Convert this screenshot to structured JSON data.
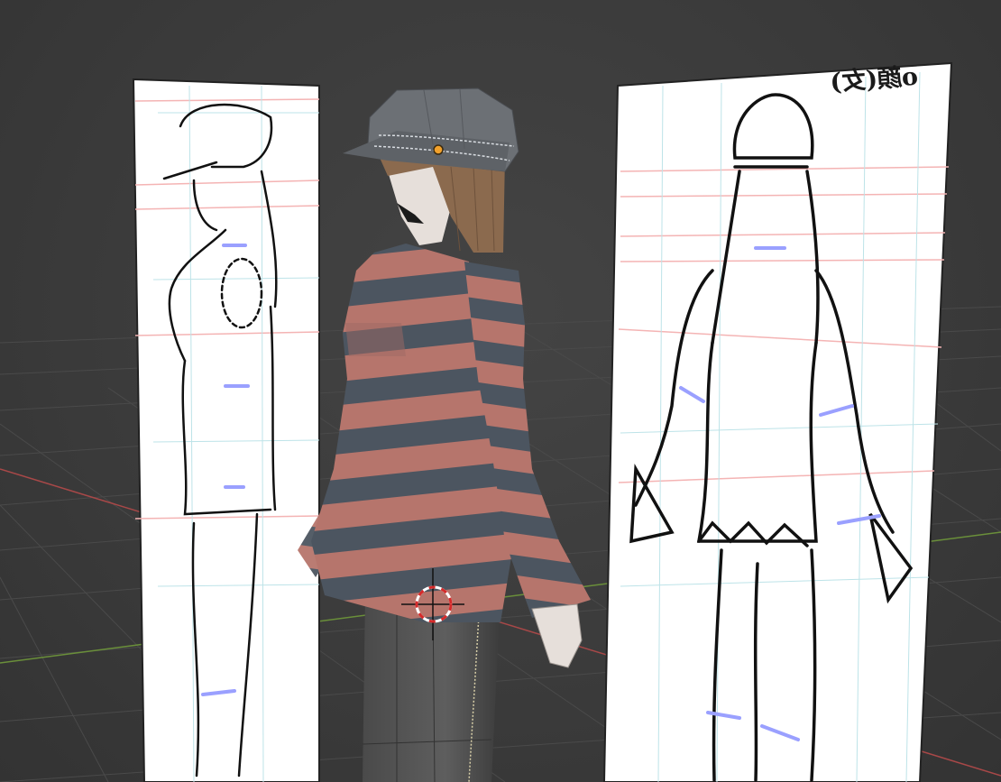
{
  "viewport": {
    "background_color": "#3d3d3d",
    "grid_color": "#4a4a4a",
    "x_axis_color": "#b34a4a",
    "y_axis_color": "#6a8f3a"
  },
  "reference_images": {
    "side_view": {
      "name": "side-view-sketch"
    },
    "front_view": {
      "name": "front-view-sketch",
      "label": "o顔(女)"
    }
  },
  "model": {
    "cap_color": "#6c7075",
    "hair_color": "#8b6a4e",
    "skin_color": "#e6dfda",
    "sweater_stripe_colors": [
      "#b6756c",
      "#4c5560"
    ],
    "pants_color": "#5a5a5a",
    "origin_point_color": "#f2a12b"
  },
  "cursor_3d": {
    "name": "3d-cursor"
  }
}
